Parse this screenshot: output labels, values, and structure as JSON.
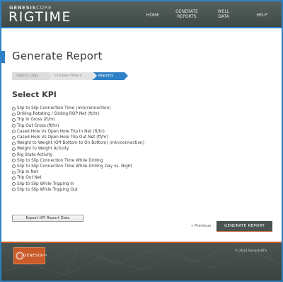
{
  "header": {
    "brand_top_bold": "GENESIS",
    "brand_top_light": "CORE",
    "brand_main": "RIGTIME",
    "nav": [
      {
        "label": "HOME"
      },
      {
        "label_line1": "GENERATE",
        "label_line2": "REPORTS"
      },
      {
        "label_line1": "WELL",
        "label_line2": "DATA"
      },
      {
        "label": "HELP"
      }
    ]
  },
  "page": {
    "title": "Generate Report",
    "steps": [
      "Select Logs",
      "Choose Filters",
      "Reports"
    ],
    "active_step": "Reports",
    "kpi_heading": "Select KPI",
    "kpis": [
      "Slip to Slip Connection Time (min/connection)",
      "Drilling Rotating / Sliding ROP Net (ft/hr)",
      "Trip In Gross (ft/hr)",
      "Trip Out Gross (ft/hr)",
      "Cased Hole Vs Open Hole Trip In Net (ft/hr)",
      "Cased Hole Vs Open Hole Trip Out Net (ft/hr)",
      "Weight to Weight (Off Bottom to On Bottom) (min/connection)",
      "Weight to Weight Activity",
      "Rig State Activity",
      "Slip to Slip Connection Time While Drilling",
      "Slip to Slip Connection Time While Drilling Day vs. Night",
      "Trip In Net",
      "Trip Out Net",
      "Slip to Slip While Tripping In",
      "Slip to Slip While Tripping Out"
    ],
    "export_label": "Export KPI Report Data",
    "prev_label": "« Previous",
    "generate_label": "GENERATE REPORT"
  },
  "footer": {
    "logo_text": "GENESIS",
    "logo_sup": "RTS",
    "copyright": "© 2014 GenesisRTS"
  },
  "colors": {
    "accent_blue": "#2f80c6",
    "accent_orange": "#c95b28",
    "header_bg": "#4b5451"
  }
}
